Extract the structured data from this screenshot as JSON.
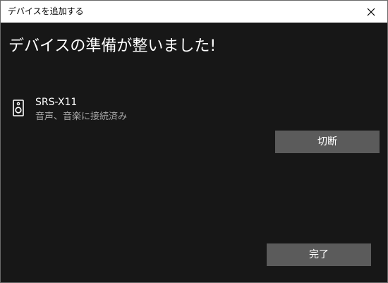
{
  "window": {
    "title": "デバイスを追加する",
    "close_icon": "close-icon"
  },
  "main": {
    "heading": "デバイスの準備が整いました!"
  },
  "device": {
    "icon": "speaker-icon",
    "name": "SRS-X11",
    "status": "音声、音楽に接続済み"
  },
  "buttons": {
    "disconnect_label": "切断",
    "done_label": "完了"
  },
  "colors": {
    "background": "#171717",
    "titlebar": "#ffffff",
    "button": "#5b5b5b",
    "secondary_text": "#a8a8a8"
  }
}
